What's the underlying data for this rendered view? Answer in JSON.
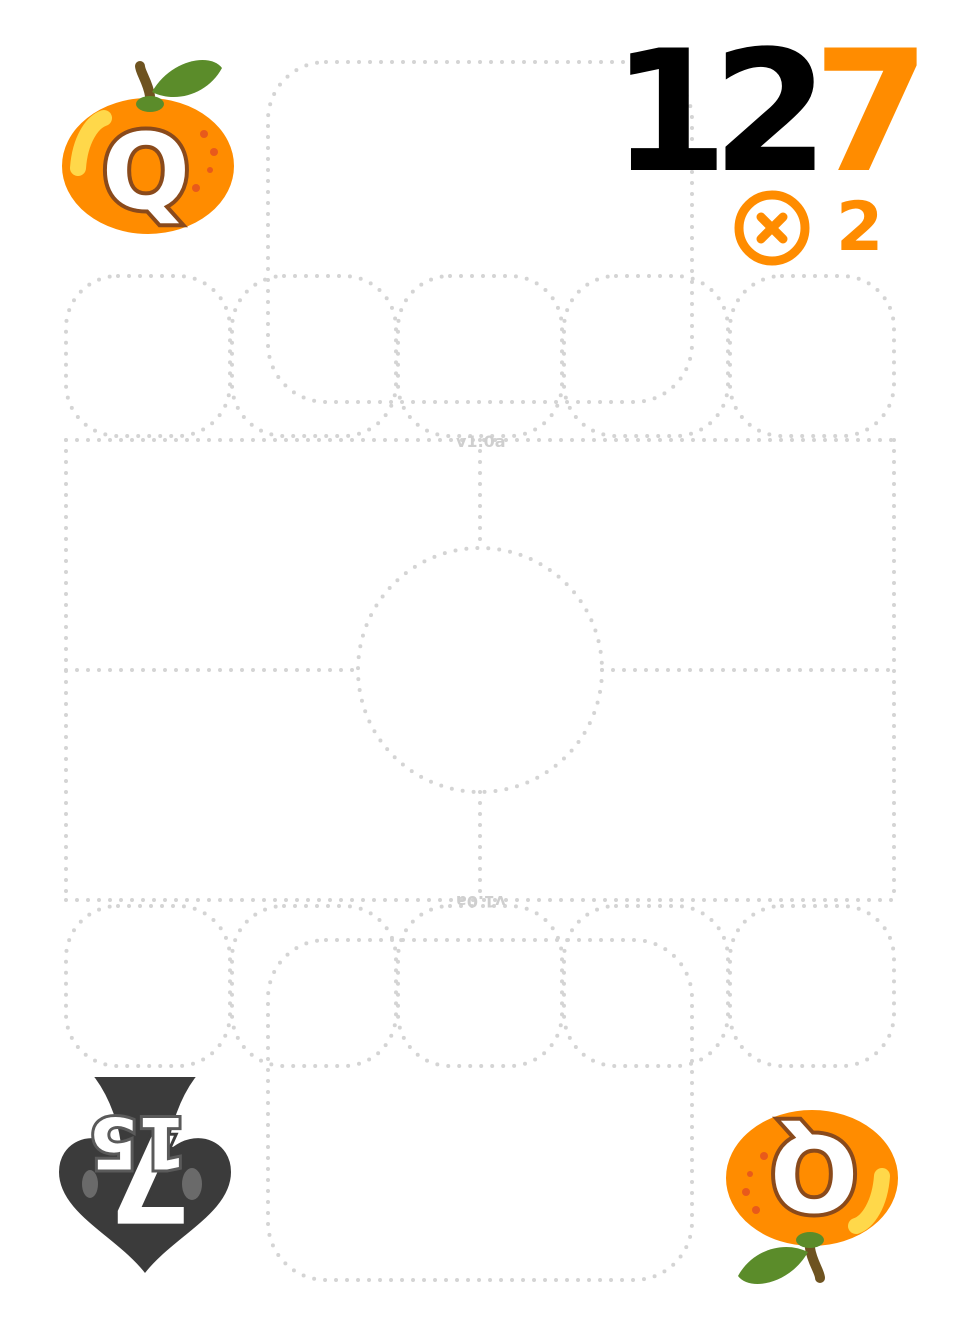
{
  "card": {
    "rank_letter": "Q",
    "suit_icon": "orange-fruit-icon",
    "score_prefix": "12",
    "score_accent": "7",
    "multiplier": "2",
    "multiplier_icon": "circled-x-icon",
    "version_top": "v1.0a",
    "version_bottom": "v1.0a",
    "opponent_rank": "7",
    "opponent_value": "15",
    "opponent_suit_icon": "spade-icon"
  },
  "colors": {
    "accent": "#ff8c00",
    "orange_fill": "#ff8c00",
    "orange_outline": "#b85a1b",
    "leaf": "#5b8c2a",
    "spade": "#3b3b3b",
    "dotted_guides": "#d6d6d6"
  }
}
